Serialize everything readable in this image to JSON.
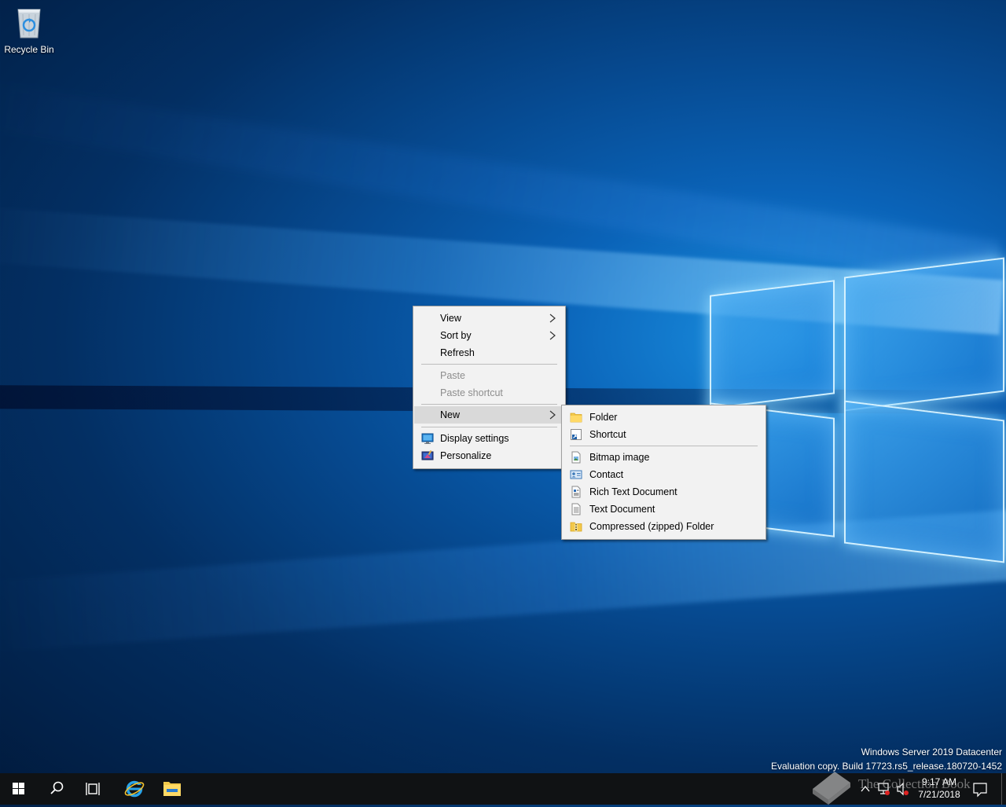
{
  "desktop": {
    "recycle_bin_label": "Recycle Bin"
  },
  "context_menu": {
    "items": [
      {
        "label": "View",
        "submenu": true,
        "enabled": true
      },
      {
        "label": "Sort by",
        "submenu": true,
        "enabled": true
      },
      {
        "label": "Refresh",
        "submenu": false,
        "enabled": true
      },
      {
        "label": "Paste",
        "submenu": false,
        "enabled": false
      },
      {
        "label": "Paste shortcut",
        "submenu": false,
        "enabled": false
      },
      {
        "label": "New",
        "submenu": true,
        "enabled": true,
        "highlighted": true
      },
      {
        "label": "Display settings",
        "icon": "display-icon",
        "enabled": true
      },
      {
        "label": "Personalize",
        "icon": "personalize-icon",
        "enabled": true
      }
    ]
  },
  "new_submenu": {
    "items": [
      {
        "label": "Folder",
        "icon": "folder-icon"
      },
      {
        "label": "Shortcut",
        "icon": "shortcut-icon"
      },
      {
        "label": "Bitmap image",
        "icon": "bitmap-icon"
      },
      {
        "label": "Contact",
        "icon": "contact-icon"
      },
      {
        "label": "Rich Text Document",
        "icon": "rich-text-icon"
      },
      {
        "label": "Text Document",
        "icon": "text-document-icon"
      },
      {
        "label": "Compressed (zipped) Folder",
        "icon": "zip-folder-icon"
      }
    ]
  },
  "watermark": {
    "line1": "Windows Server 2019 Datacenter",
    "line2": "Evaluation copy. Build 17723.rs5_release.180720-1452"
  },
  "taskbar": {
    "pinned": [
      "start-icon",
      "search-icon",
      "task-view-icon",
      "internet-explorer-icon",
      "file-explorer-icon"
    ],
    "clock_time": "9:17 AM",
    "clock_date": "7/21/2018"
  },
  "overlay": {
    "brand_text": "The Collection Book"
  },
  "colors": {
    "menu_bg": "#f2f2f2",
    "menu_highlight": "#d9d9d9",
    "taskbar_bg": "#101214",
    "disabled_text": "#8d8d8d"
  }
}
